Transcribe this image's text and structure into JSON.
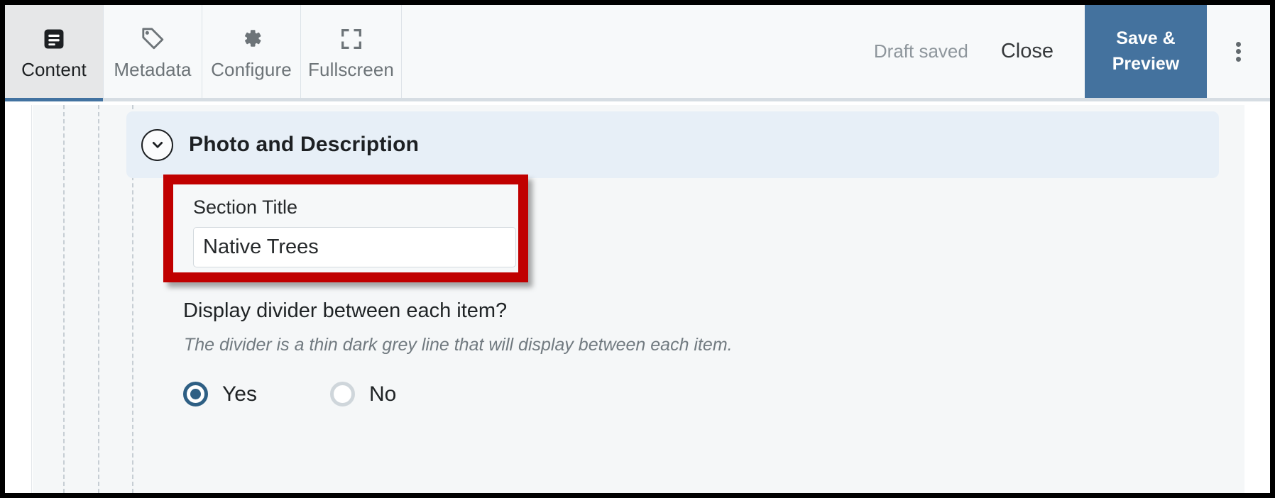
{
  "toolbar": {
    "tabs": [
      {
        "label": "Content",
        "icon": "document-lines-icon",
        "active": true
      },
      {
        "label": "Metadata",
        "icon": "tag-icon",
        "active": false
      },
      {
        "label": "Configure",
        "icon": "gear-icon",
        "active": false
      },
      {
        "label": "Fullscreen",
        "icon": "expand-icon",
        "active": false
      }
    ],
    "draft_status": "Draft saved",
    "close_label": "Close",
    "save_preview_label": "Save &\nPreview",
    "save_preview_line1": "Save &",
    "save_preview_line2": "Preview",
    "overflow_icon": "kebab-menu-icon",
    "accent_color": "#44729e",
    "active_underline_color": "#4272a0"
  },
  "section": {
    "header_title": "Photo and Description",
    "collapse_icon": "chevron-down-icon",
    "header_bg": "#e7eff7"
  },
  "form": {
    "section_title_label": "Section Title",
    "section_title_value": "Native Trees",
    "section_title_placeholder": "",
    "highlight_color": "#c00000",
    "divider_question": "Display divider between each item?",
    "divider_help": "The divider is a thin dark grey line that will display between each item.",
    "radio_options": [
      {
        "label": "Yes",
        "checked": true
      },
      {
        "label": "No",
        "checked": false
      }
    ],
    "radio_selected_color": "#2e5f84"
  }
}
